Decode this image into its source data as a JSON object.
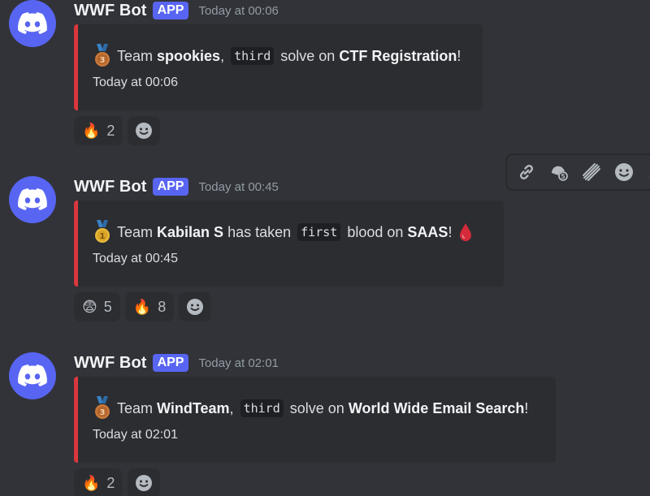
{
  "messages": [
    {
      "username": "WWF Bot",
      "badge": "APP",
      "timestamp": "Today at 00:06",
      "embed": {
        "medal": "3",
        "prefix": "Team ",
        "team": "spookies",
        "sep": ",",
        "code": "third",
        "mid": "solve on",
        "challenge": "CTF Registration",
        "suffix": "!",
        "time": "Today at 00:06"
      },
      "reactions": [
        {
          "emoji": "🔥",
          "count": "2"
        }
      ]
    },
    {
      "username": "WWF Bot",
      "badge": "APP",
      "timestamp": "Today at 00:45",
      "embed": {
        "medal": "1",
        "prefix": "Team ",
        "team": "Kabilan S",
        "pre_code": "has taken",
        "code": "first",
        "mid": "blood on",
        "challenge": "SAAS",
        "suffix": "!",
        "time": "Today at 00:45"
      },
      "reactions": [
        {
          "emoji": "😨",
          "count": "5"
        },
        {
          "emoji": "🔥",
          "count": "8"
        }
      ]
    },
    {
      "username": "WWF Bot",
      "badge": "APP",
      "timestamp": "Today at 02:01",
      "embed": {
        "medal": "3",
        "prefix": "Team ",
        "team": "WindTeam",
        "sep": ",",
        "code": "third",
        "mid": "solve on",
        "challenge": "World Wide Email Search",
        "suffix": "!",
        "time": "Today at 02:01"
      },
      "reactions": [
        {
          "emoji": "🔥",
          "count": "2"
        }
      ]
    }
  ],
  "toolbar_icons": [
    "link-icon",
    "reply-thread-icon",
    "super-reaction-icon",
    "add-reaction-icon",
    "more-icon"
  ],
  "colors": {
    "background": "#313338",
    "embed_bg": "#2b2d31",
    "embed_border": "#da373c",
    "blurple": "#5865f2"
  }
}
